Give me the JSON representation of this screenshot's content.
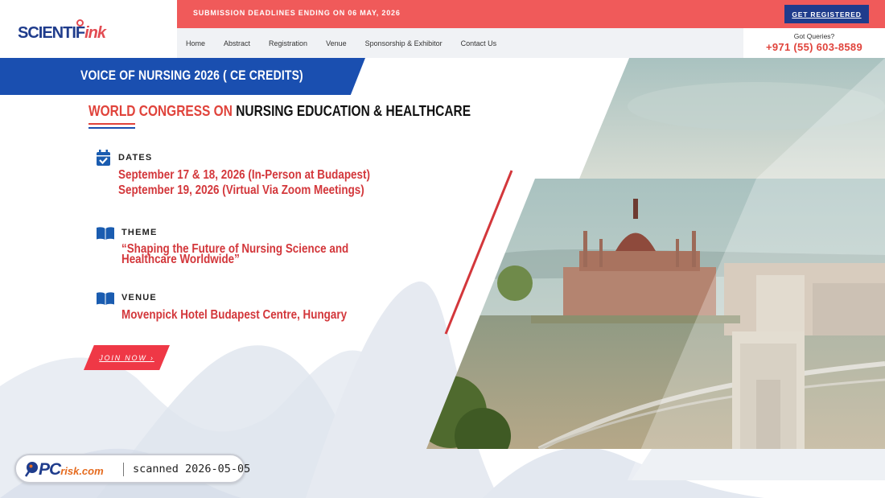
{
  "brand": {
    "logo_text": "SCIENTIF",
    "logo_text_accent": "ink"
  },
  "topbar": {
    "notice": "SUBMISSION DEADLINES ENDING ON 06 MAY, 2026",
    "cta_label": "GET REGISTERED"
  },
  "nav": {
    "items": [
      {
        "label": "Home",
        "icon": ""
      },
      {
        "label": "Abstract",
        "icon": ""
      },
      {
        "label": "Registration",
        "icon": ""
      },
      {
        "label": "Venue",
        "icon": ""
      },
      {
        "label": "Sponsorship & Exhibitor",
        "icon": ""
      },
      {
        "label": "Contact Us",
        "icon": ""
      }
    ]
  },
  "contact": {
    "label": "Got Queries?",
    "phone": "+971 (55) 603-8589"
  },
  "banner": {
    "title": "VOICE OF NURSING 2026 ( CE CREDITS)"
  },
  "headline": {
    "prefix": "WORLD CONGRESS ON",
    "main": "NURSING EDUCATION & HEALTHCARE"
  },
  "info": {
    "dates": {
      "label": "DATES",
      "icon": "calendar-check-icon",
      "line1": "September 17 & 18, 2026 (In-Person at Budapest)",
      "line2": "September 19, 2026 (Virtual Via Zoom Meetings)"
    },
    "theme": {
      "label": "THEME",
      "icon": "open-book-icon",
      "value": "“Shaping the Future of Nursing Science and Healthcare Worldwide”"
    },
    "venue": {
      "label": "VENUE",
      "icon": "open-book-icon",
      "value": "Movenpick Hotel Budapest Centre, Hungary"
    }
  },
  "join": {
    "label": "JOIN NOW ›"
  },
  "scan_badge": {
    "logo": "PC",
    "logo_sub": "risk.com",
    "text": "scanned 2026-05-05"
  },
  "colors": {
    "accent_red": "#e0433b",
    "topbar_red": "#f05a5a",
    "brand_blue": "#1a4fb0",
    "cta_navy": "#1f3c8c"
  }
}
